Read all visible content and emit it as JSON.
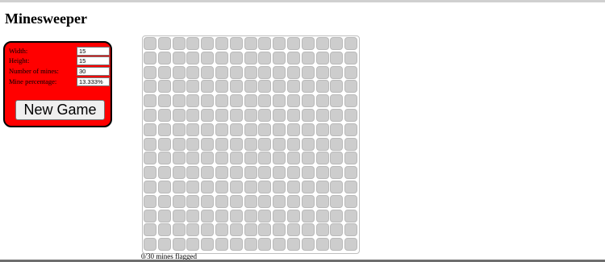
{
  "page": {
    "title": "Minesweeper"
  },
  "settings": {
    "width": {
      "label": "Width:",
      "value": "15"
    },
    "height": {
      "label": "Height:",
      "value": "15"
    },
    "mines": {
      "label": "Number of mines:",
      "value": "30"
    },
    "percentage": {
      "label": "Mine percentage:",
      "value": "13.333%"
    }
  },
  "new_game_label": "New Game",
  "board": {
    "columns": 15,
    "rows": 15
  },
  "status": {
    "text": "0/30 mines flagged"
  },
  "colors": {
    "panel": "#ff0000",
    "cell": "#cdcdcd"
  }
}
